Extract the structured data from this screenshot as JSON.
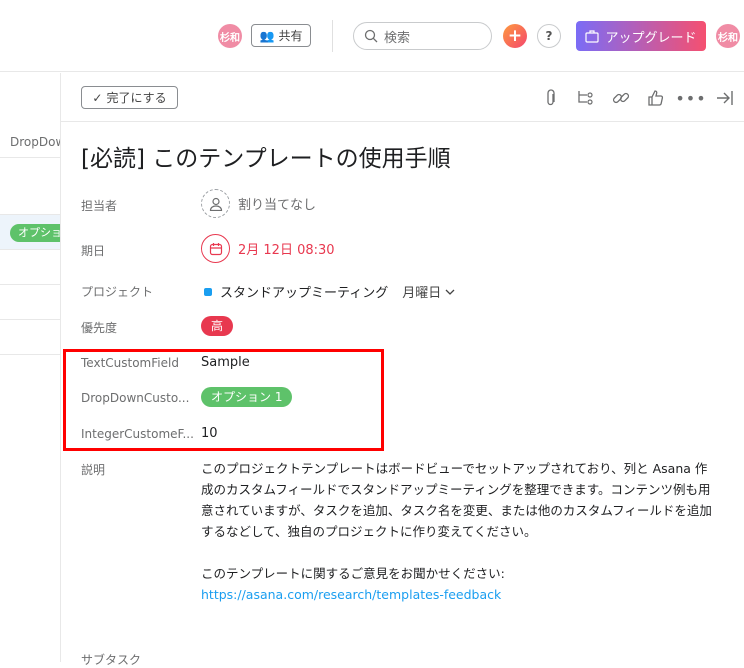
{
  "topbar": {
    "avatar_initials": "杉和",
    "share_label": "共有",
    "search_placeholder": "検索",
    "help_label": "?",
    "upgrade_label": "アップグレード",
    "upgrade_colors": [
      "#7b6cf6",
      "#f55070"
    ]
  },
  "left_panel": {
    "column_header": "DropDow",
    "pill_label": "オプショ"
  },
  "toolbar": {
    "complete_label": "完了にする"
  },
  "task": {
    "title": "[必読] このテンプレートの使用手順",
    "fields": {
      "assignee": {
        "label": "担当者",
        "value": "割り当てなし"
      },
      "due": {
        "label": "期日",
        "value": "2月 12日 08:30"
      },
      "project": {
        "label": "プロジェクト",
        "value": "スタンドアップミーティング",
        "section": "月曜日"
      },
      "priority": {
        "label": "優先度",
        "value": "高",
        "color": "#e8384f"
      },
      "text_custom": {
        "label": "TextCustomField",
        "value": "Sample"
      },
      "dropdown_custom": {
        "label": "DropDownCusto...",
        "value": "オプション 1",
        "color": "#5ec26a"
      },
      "integer_custom": {
        "label": "IntegerCustomeF...",
        "value": "10"
      }
    },
    "description": {
      "label": "説明",
      "paragraph1": "このプロジェクトテンプレートはボードビューでセットアップされており、列と Asana 作成のカスタムフィールドでスタンドアップミーティングを整理できます。コンテンツ例も用意されていますが、タスクを追加、タスク名を変更、または他のカスタムフィールドを追加するなどして、独自のプロジェクトに作り変えてください。",
      "paragraph2": "このテンプレートに関するご意見をお聞かせください:",
      "link": "https://asana.com/research/templates-feedback"
    },
    "subtasks_label": "サブタスク"
  }
}
